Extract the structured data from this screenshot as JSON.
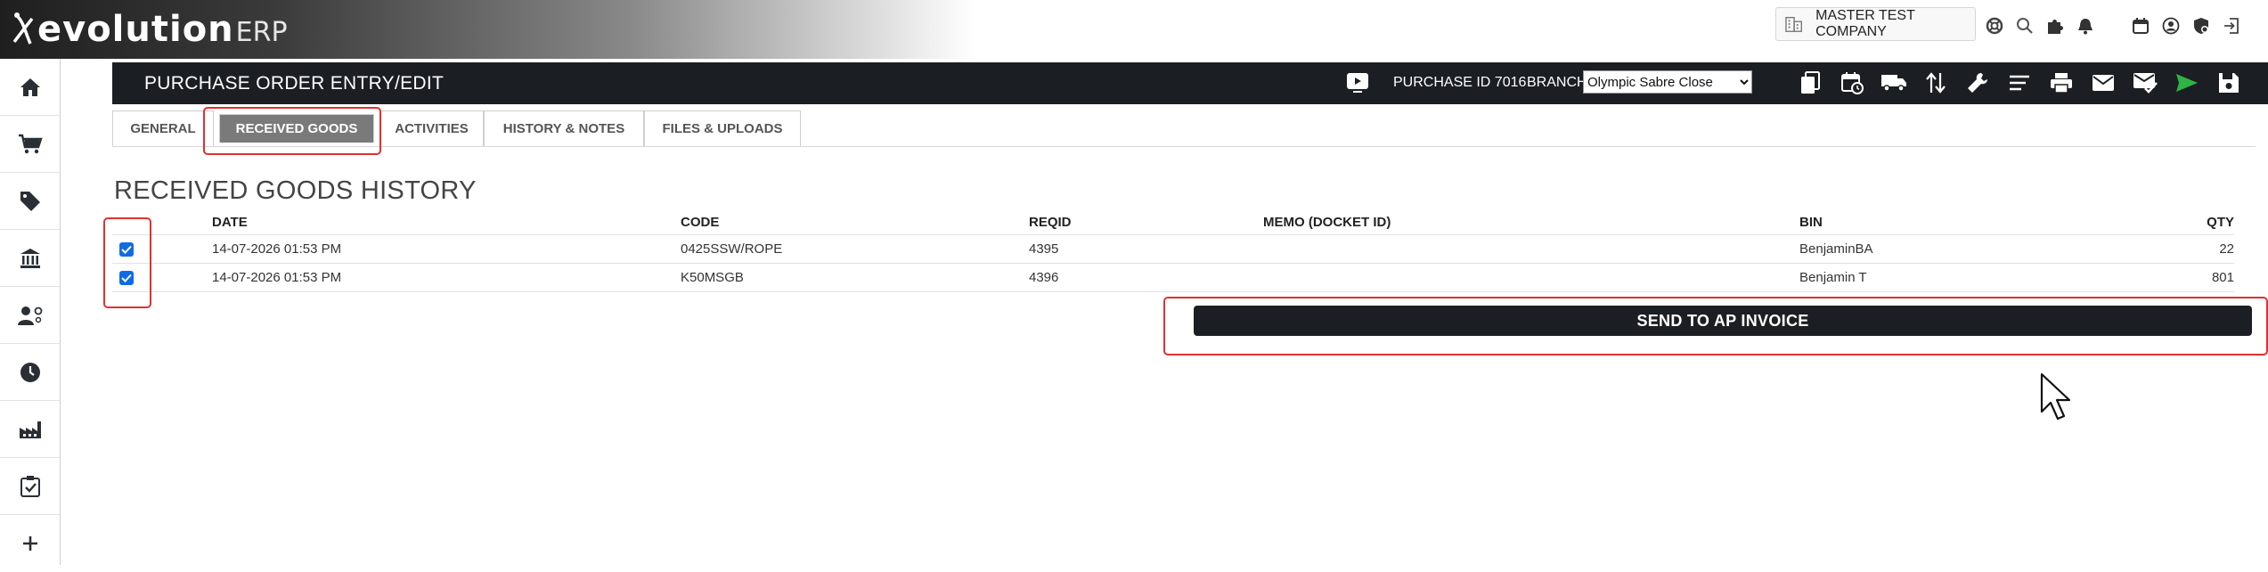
{
  "app": {
    "brand": "evolution",
    "brand_suffix": "ERP",
    "company": "MASTER TEST COMPANY"
  },
  "header_icons": [
    "help-lifebuoy-icon",
    "search-icon",
    "puzzle-icon",
    "bell-icon",
    "calendar-icon",
    "user-circle-icon",
    "shield-icon",
    "logout-icon"
  ],
  "sidebar": {
    "items": [
      {
        "name": "home",
        "icon": "home-icon"
      },
      {
        "name": "purchasing",
        "icon": "cart-icon"
      },
      {
        "name": "sales",
        "icon": "tag-icon"
      },
      {
        "name": "banking",
        "icon": "bank-icon"
      },
      {
        "name": "people",
        "icon": "user-gear-icon"
      },
      {
        "name": "time",
        "icon": "clock-icon"
      },
      {
        "name": "manufacturing",
        "icon": "factory-icon"
      },
      {
        "name": "tasks",
        "icon": "clipboard-check-icon"
      }
    ]
  },
  "titlebar": {
    "title": "PURCHASE ORDER ENTRY/EDIT",
    "purchase_id": "PURCHASE ID 7016",
    "branch_label": "BRANCH",
    "branch_selected": "Olympic Sabre Close",
    "tools": [
      "copy-icon",
      "calendar-clock-icon",
      "truck-icon",
      "transfer-arrows-icon",
      "wrench-icon",
      "list-icon",
      "print-icon",
      "email-icon",
      "email-check-icon",
      "send-icon",
      "save-icon"
    ]
  },
  "tabs": [
    {
      "label": "GENERAL",
      "active": false
    },
    {
      "label": "RECEIVED GOODS",
      "active": true
    },
    {
      "label": "ACTIVITIES",
      "active": false
    },
    {
      "label": "HISTORY & NOTES",
      "active": false
    },
    {
      "label": "FILES & UPLOADS",
      "active": false
    }
  ],
  "section": {
    "title": "RECEIVED GOODS HISTORY",
    "columns": [
      "DATE",
      "CODE",
      "REQID",
      "MEMO (DOCKET ID)",
      "BIN",
      "QTY"
    ],
    "rows": [
      {
        "checked": true,
        "date": "14-07-2026 01:53 PM",
        "code": "0425SSW/ROPE",
        "reqid": "4395",
        "memo": "",
        "bin": "BenjaminBA",
        "qty": "22"
      },
      {
        "checked": true,
        "date": "14-07-2026 01:53 PM",
        "code": "K50MSGB",
        "reqid": "4396",
        "memo": "",
        "bin": "Benjamin T",
        "qty": "801"
      }
    ]
  },
  "send_button": "SEND TO AP INVOICE",
  "colors": {
    "dark_bar": "#1b1f24",
    "active_tab": "#7a7a7a",
    "highlight": "#e03131",
    "checkbox": "#0f6be3",
    "send_icon": "#2fb344"
  }
}
